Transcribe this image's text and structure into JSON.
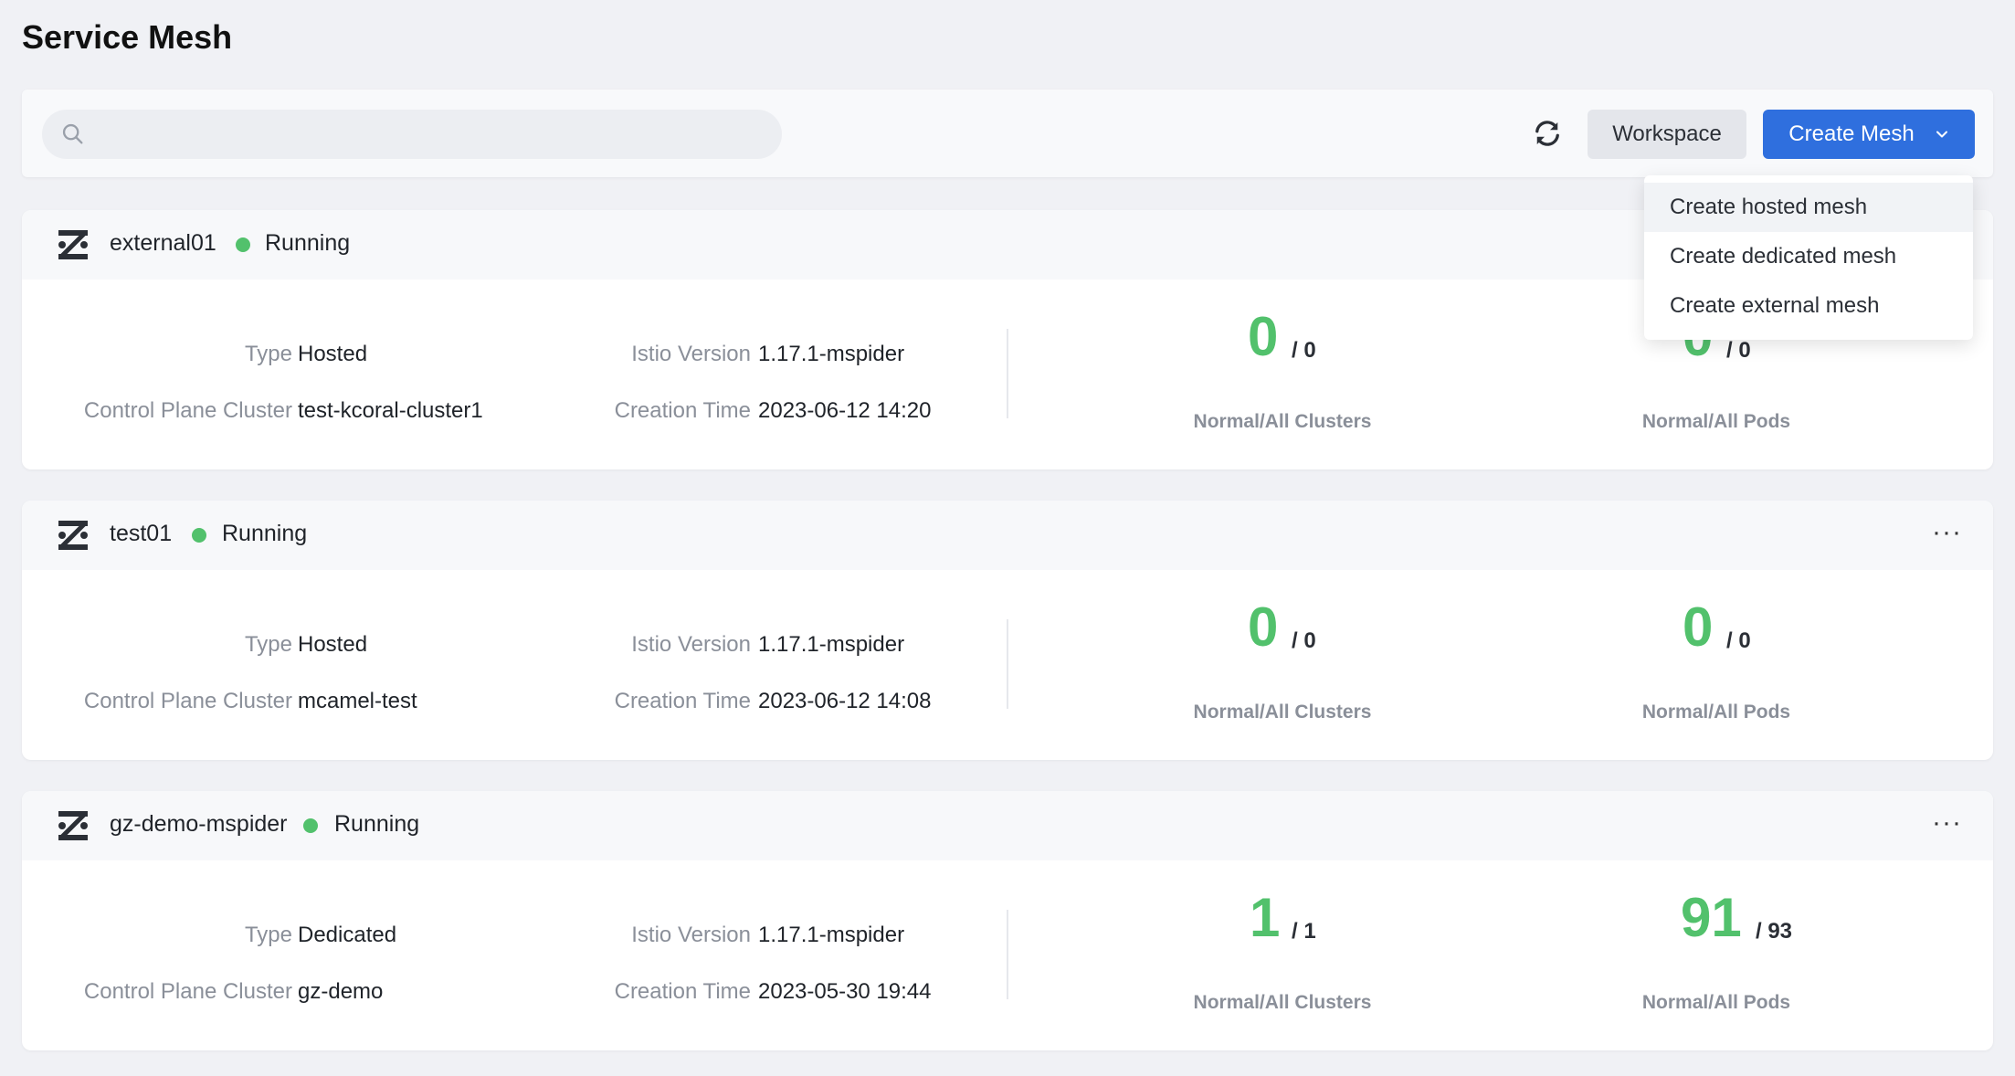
{
  "page": {
    "title": "Service Mesh"
  },
  "toolbar": {
    "search_placeholder": "",
    "refresh_icon": "refresh-icon",
    "workspace_label": "Workspace",
    "create_label": "Create Mesh"
  },
  "dropdown": {
    "items": [
      {
        "label": "Create hosted mesh"
      },
      {
        "label": "Create dedicated mesh"
      },
      {
        "label": "Create external mesh"
      }
    ]
  },
  "labels": {
    "type": "Type",
    "control_plane_cluster": "Control Plane Cluster",
    "istio_version": "Istio Version",
    "creation_time": "Creation Time",
    "clusters_stat": "Normal/All Clusters",
    "pods_stat": "Normal/All Pods"
  },
  "colors": {
    "accent": "#2f6fde",
    "running": "#52c16c"
  },
  "meshes": [
    {
      "name": "external01",
      "status": "Running",
      "type": "Hosted",
      "cluster": "test-kcoral-cluster1",
      "istio_version": "1.17.1-mspider",
      "creation_time": "2023-06-12 14:20",
      "clusters_normal": "0",
      "clusters_all": "/ 0",
      "pods_normal": "0",
      "pods_all": "/ 0"
    },
    {
      "name": "test01",
      "status": "Running",
      "type": "Hosted",
      "cluster": "mcamel-test",
      "istio_version": "1.17.1-mspider",
      "creation_time": "2023-06-12 14:08",
      "clusters_normal": "0",
      "clusters_all": "/ 0",
      "pods_normal": "0",
      "pods_all": "/ 0"
    },
    {
      "name": "gz-demo-mspider",
      "status": "Running",
      "type": "Dedicated",
      "cluster": "gz-demo",
      "istio_version": "1.17.1-mspider",
      "creation_time": "2023-05-30 19:44",
      "clusters_normal": "1",
      "clusters_all": "/ 1",
      "pods_normal": "91",
      "pods_all": "/ 93"
    }
  ]
}
